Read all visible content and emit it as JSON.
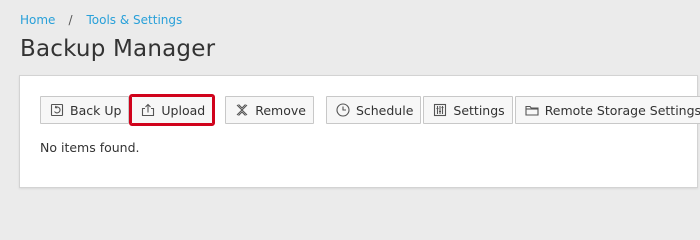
{
  "breadcrumb": {
    "home": "Home",
    "separator": "/",
    "section": "Tools & Settings"
  },
  "page": {
    "title": "Backup Manager"
  },
  "toolbar": {
    "back_up": {
      "label": "Back Up",
      "icon": "backup-icon"
    },
    "upload": {
      "label": "Upload",
      "icon": "upload-icon"
    },
    "remove": {
      "label": "Remove",
      "icon": "remove-icon"
    },
    "schedule": {
      "label": "Schedule",
      "icon": "clock-icon"
    },
    "settings": {
      "label": "Settings",
      "icon": "sliders-icon"
    },
    "remote_storage": {
      "label": "Remote Storage Settings",
      "icon": "folder-icon"
    }
  },
  "list": {
    "empty_message": "No items found."
  },
  "colors": {
    "link": "#28a0d9",
    "highlight": "#d0021b",
    "background": "#ebebeb"
  }
}
